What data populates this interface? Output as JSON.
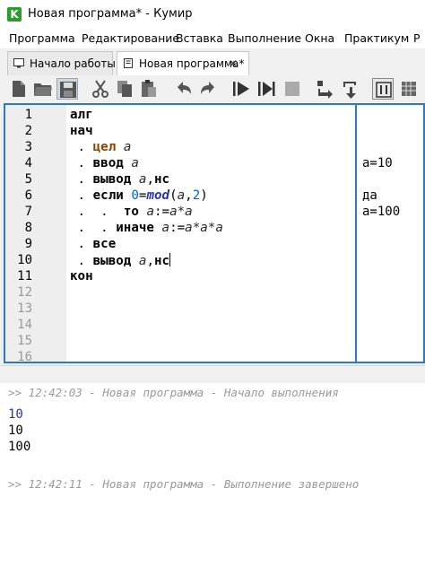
{
  "window": {
    "title": "Новая программа* - Кумир",
    "icon": "kumir-app-icon",
    "icon_letter": "K"
  },
  "menu": {
    "items": [
      "Программа",
      "Редактирование",
      "Вставка",
      "Выполнение",
      "Окна",
      "Практикум",
      "Р"
    ]
  },
  "tabs": [
    {
      "label": "Начало работы",
      "icon": "monitor-icon"
    },
    {
      "label": "Новая программа*",
      "icon": "document-icon",
      "close": "✕"
    }
  ],
  "toolbar": {
    "buttons": [
      "new-file",
      "open-folder",
      "save",
      "cut",
      "copy",
      "paste",
      "undo",
      "redo",
      "run",
      "step-run",
      "stop",
      "step-into",
      "step-out",
      "variables",
      "grid"
    ]
  },
  "editor": {
    "line_numbers": [
      "1",
      "2",
      "3",
      "4",
      "5",
      "6",
      "7",
      "8",
      "9",
      "10",
      "11",
      "12",
      "13",
      "14",
      "15",
      "16"
    ],
    "lines": {
      "l1_kw": "алг",
      "l2_kw": "нач",
      "l3_dot": ".",
      "l3_kw": "цел",
      "l3_var": "а",
      "l4_dot": ".",
      "l4_kw": "ввод",
      "l4_var": "а",
      "l5_dot": ".",
      "l5_kw": "вывод",
      "l5_var": "а",
      "l5_sep": ",",
      "l5_kw2": "нс",
      "l6_dot": ".",
      "l6_kw": "если",
      "l6_num": "0",
      "l6_eq": "=",
      "l6_fn": "mod",
      "l6_open": "(",
      "l6_var": "а",
      "l6_comma": ",",
      "l6_num2": "2",
      "l6_close": ")",
      "l7_dots": ".  .",
      "l7_kw": "то",
      "l7_var": "а",
      "l7_assign": ":=",
      "l7_expr": "а*а",
      "l8_dots": ".  .",
      "l8_kw": "иначе",
      "l8_var": "а",
      "l8_assign": ":=",
      "l8_expr": "а*а*а",
      "l9_dot": ".",
      "l9_kw": "все",
      "l10_dot": ".",
      "l10_kw": "вывод",
      "l10_var": "а",
      "l10_sep": ",",
      "l10_kw2": "нс",
      "l11_kw": "кон"
    },
    "margin": {
      "line4": "а=10",
      "line6": "да",
      "line7": "а=100"
    }
  },
  "console": {
    "start_log": ">> 12:42:03 - Новая программа - Начало выполнения",
    "input_value": "10",
    "output_1": "10",
    "output_2": "100",
    "end_log": ">> 12:42:11 - Новая программа - Выполнение завершено"
  },
  "colors": {
    "editor_border": "#2f78c8",
    "keyword_type": "#8b4500",
    "number": "#0a5fc4",
    "function": "#2233bb",
    "console_input": "#1c37b0",
    "console_log": "#999999"
  }
}
